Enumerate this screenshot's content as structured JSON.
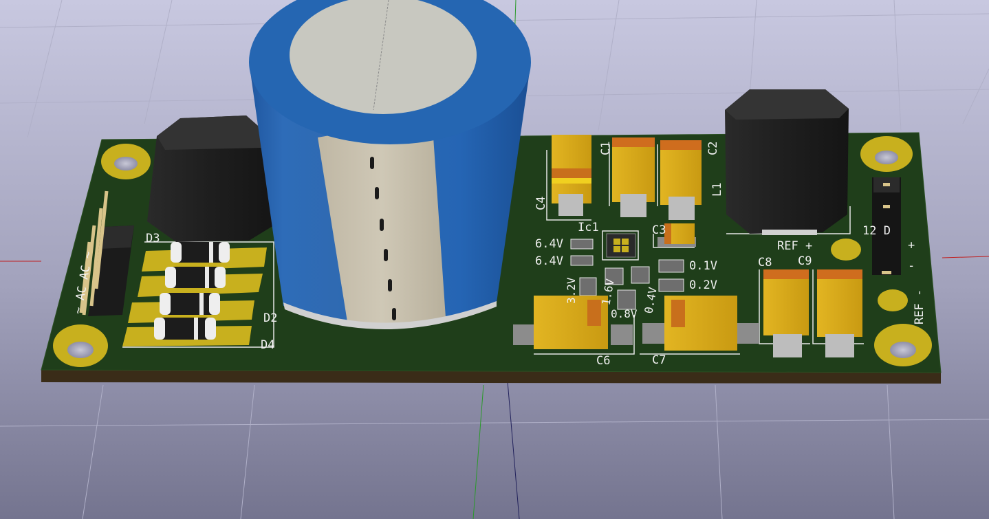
{
  "viewer": {
    "background_top": "#c4c4dc",
    "background_bottom": "#767694",
    "board_color": "#1f3e1a",
    "board_edge_color": "#3b2e1c",
    "pad_color": "#c8b01e",
    "silkscreen_color": "#f0f0f0"
  },
  "board": {
    "labels": {
      "c1": "C1",
      "c2": "C2",
      "c3": "C3",
      "c4": "C4",
      "c6": "C6",
      "c7": "C7",
      "c8": "C8",
      "c9": "C9",
      "l1": "L1",
      "ic1": "Ic1",
      "d2": "D2",
      "d3": "D3",
      "d4": "D4",
      "ac_left": "~ AC AC ~",
      "ref_plus": "REF +",
      "ref_minus": "REF -",
      "plus": "+",
      "minus": "-",
      "jumper_partial": "12  D",
      "v64a": "6.4V",
      "v64b": "6.4V",
      "v32": "3.2V",
      "v16": "1.6V",
      "v08": "0.8V",
      "v04": "0.4V",
      "v01": "0.1V",
      "v02": "0.2V"
    }
  }
}
